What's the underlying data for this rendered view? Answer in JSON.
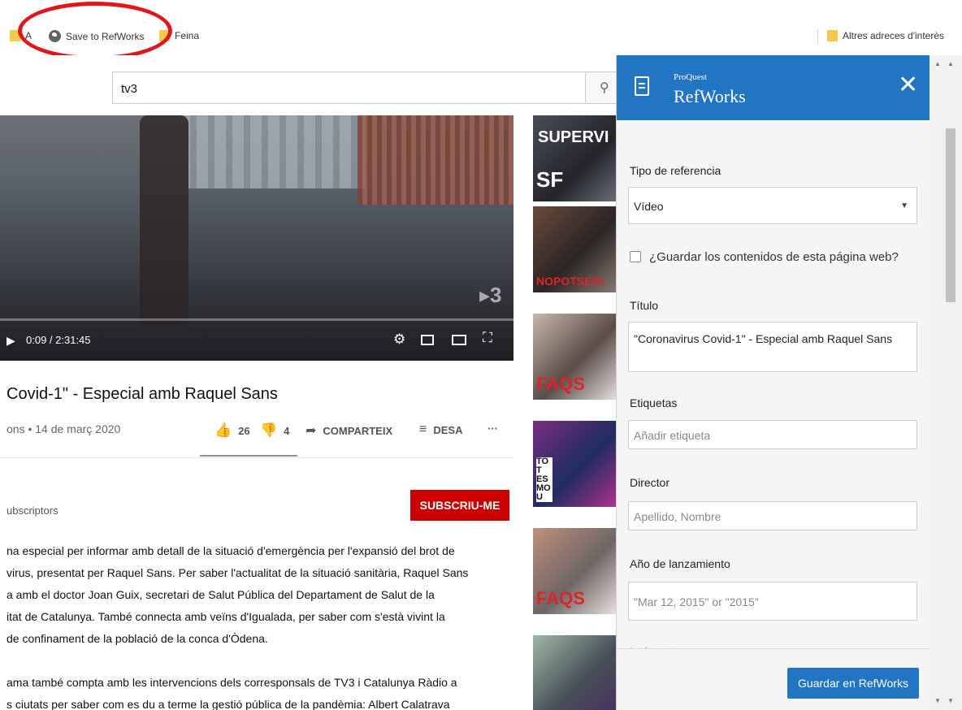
{
  "bookmarks": {
    "partial_label": "A",
    "save_to_refworks": "Save to RefWorks",
    "feina": "Feina",
    "altres": "Altres adreces d'interès"
  },
  "search": {
    "query": "tv3"
  },
  "video": {
    "logo": "▸3",
    "time": "0:09 / 2:31:45",
    "title": "Covid-1\" - Especial amb Raquel Sans",
    "meta": "ons • 14 de març 2020",
    "likes": "26",
    "dislikes": "4",
    "share": "COMPARTEIX",
    "save": "DESA",
    "more": "···"
  },
  "channel": {
    "subscribers": "ubscriptors",
    "subscribe_button": "SUBSCRIU-ME"
  },
  "description": [
    "na especial per informar amb detall de la situació d'emergència per l'expansió del brot de",
    "virus, presentat per Raquel Sans. Per saber l'actualitat de la situació sanitària, Raquel Sans",
    "a amb el doctor Joan Guix, secretari de Salut Pública del Departament de Salut de la",
    "itat de Catalunya. També connecta amb veïns d'Igualada, per saber com s'està vivint la",
    " de confinament de la població de la conca d'Òdena.",
    "ama també compta amb les intervencions dels corresponsals de TV3 i Catalunya Ràdio a",
    "s ciutats per saber com es du a terme la gestió pública de la pandèmia: Albert Calatrava"
  ],
  "related": [
    {
      "label": "SF",
      "extra": "SUPERVI"
    },
    {
      "label": "NOPOTSER!"
    },
    {
      "label": "FAQS"
    },
    {
      "label": "TOT ES MOU"
    },
    {
      "label": "FAQS"
    },
    {
      "label": ""
    }
  ],
  "refworks": {
    "brand_small": "ProQuest",
    "brand": "RefWorks",
    "close": "✕",
    "ref_type_label": "Tipo de referencia",
    "ref_type_value": "Vídeo",
    "save_contents_label": "¿Guardar los contenidos de esta página web?",
    "title_label": "Título",
    "title_value": "\"Coronavirus Covid-1\" - Especial amb Raquel Sans",
    "tags_label": "Etiquetas",
    "tags_placeholder": "Añadir etiqueta",
    "director_label": "Director",
    "director_placeholder": "Apellido, Nombre",
    "year_label": "Año de lanzamiento",
    "year_placeholder": "\"Mar 12, 2015\" or \"2015\"",
    "next_label": "Intérpretes",
    "save_button": "Guardar en RefWorks"
  }
}
